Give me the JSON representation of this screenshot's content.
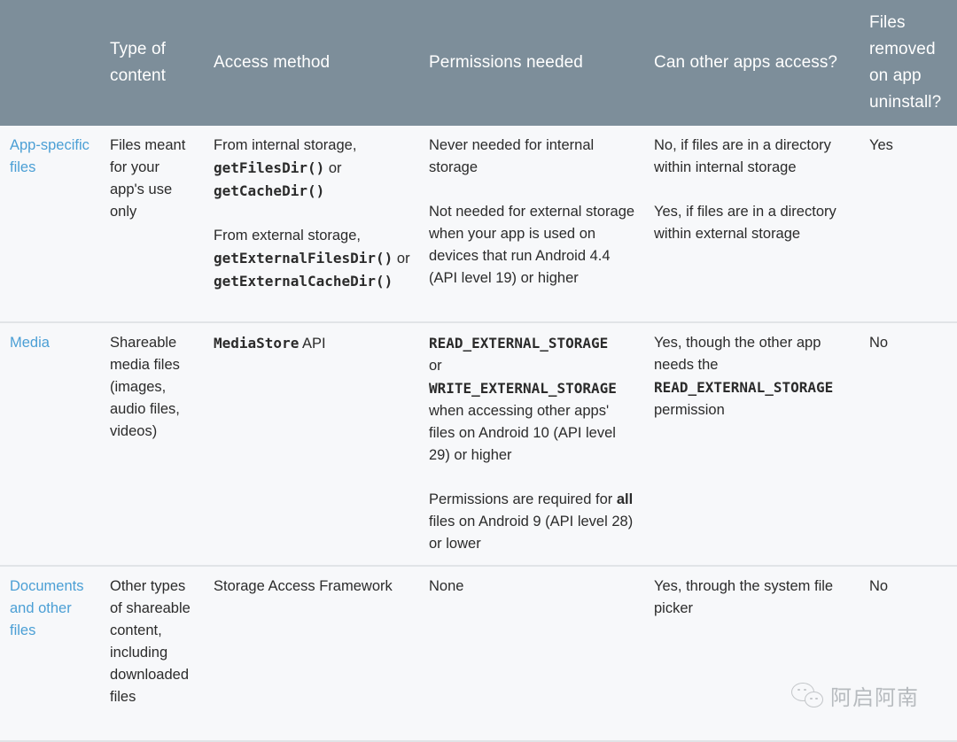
{
  "table": {
    "headers": [
      "",
      "Type of content",
      "Access method",
      "Permissions needed",
      "Can other apps access?",
      "Files removed on app uninstall?"
    ],
    "rows": [
      {
        "label": "App-specific files",
        "type_of_content": "Files meant for your app's use only",
        "access_method": {
          "p1_text": "From internal storage,",
          "p1_code1": "getFilesDir()",
          "p1_or": "or",
          "p1_code2": "getCacheDir()",
          "p2_text": "From external storage,",
          "p2_code1": "getExternalFilesDir()",
          "p2_or": "or",
          "p2_code2": "getExternalCacheDir()"
        },
        "permissions": {
          "p1": "Never needed for internal storage",
          "p2": "Not needed for external storage when your app is used on devices that run Android 4.4 (API level 19) or higher"
        },
        "other_apps": {
          "p1": "No, if files are in a directory within internal storage",
          "p2": "Yes, if files are in a directory within external storage"
        },
        "removed_on_uninstall": "Yes"
      },
      {
        "label": "Media",
        "type_of_content": "Shareable media files (images, audio files, videos)",
        "access_method": {
          "code": "MediaStore",
          "text": "API"
        },
        "permissions": {
          "code1": "READ_EXTERNAL_STORAGE",
          "or": "or",
          "code2": "WRITE_EXTERNAL_STORAGE",
          "p1_rest": "when accessing other apps' files on Android 10 (API level 29) or higher",
          "p2_start": "Permissions are required for",
          "p2_bold": "all",
          "p2_rest": "files on Android 9 (API level 28) or lower"
        },
        "other_apps": {
          "text1": "Yes, though the other app needs the",
          "code": "READ_EXTERNAL_STORAGE",
          "text2": "permission"
        },
        "removed_on_uninstall": "No"
      },
      {
        "label": "Documents and other files",
        "type_of_content": "Other types of shareable content, including downloaded files",
        "access_method": "Storage Access Framework",
        "permissions": "None",
        "other_apps": "Yes, through the system file picker",
        "removed_on_uninstall": "No"
      }
    ]
  },
  "watermark": {
    "icon": "wechat-icon",
    "text": "阿启阿南"
  },
  "colors": {
    "header_bg": "#7d8e9a",
    "header_text": "#ffffff",
    "row_label": "#4b9fd5",
    "body_bg": "#f7f8fa",
    "divider": "#e1e4e7"
  }
}
